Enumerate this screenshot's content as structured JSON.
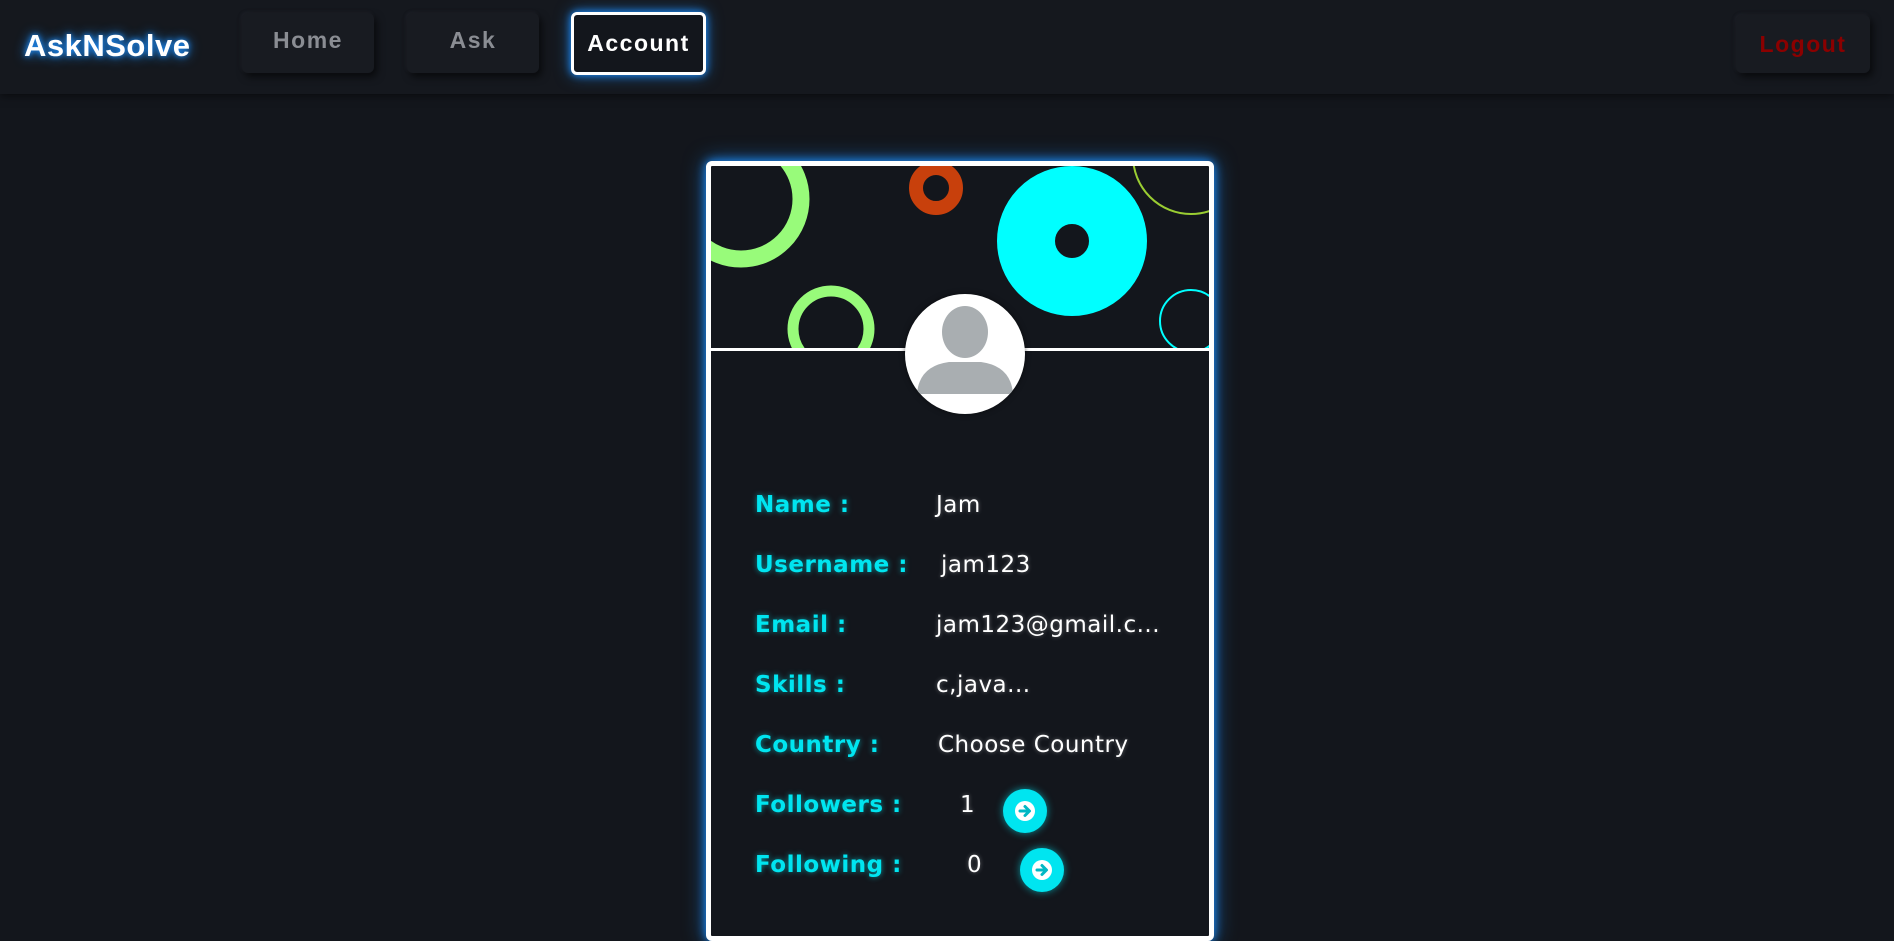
{
  "navbar": {
    "brand": "AskNSolve",
    "home_label": "Home",
    "ask_label": "Ask",
    "account_label": "Account",
    "logout_label": "Logout"
  },
  "profile": {
    "avatar_icon": "user-avatar-icon",
    "fields": [
      {
        "label": "Name :",
        "value": "Jam"
      },
      {
        "label": "Username :",
        "value": "jam123"
      },
      {
        "label": "Email :",
        "value": "jam123@gmail.c..."
      },
      {
        "label": "Skills :",
        "value": "c,java..."
      },
      {
        "label": "Country :",
        "value": "Choose Country"
      },
      {
        "label": "Followers :",
        "value": "1"
      },
      {
        "label": "Following :",
        "value": "0"
      }
    ],
    "followers_action_icon": "arrow-right-circle-icon",
    "following_action_icon": "arrow-right-circle-icon"
  },
  "colors": {
    "accent": "#00e5f0",
    "background": "#13161c",
    "glow": "#1e90ff",
    "logout": "#8b0000",
    "decor_green": "#98fb7a",
    "decor_orange": "#c8400c"
  }
}
